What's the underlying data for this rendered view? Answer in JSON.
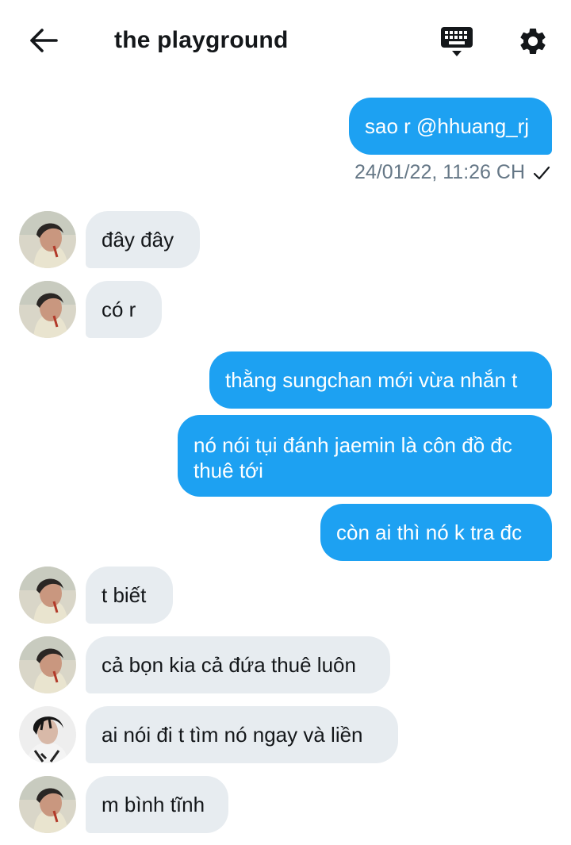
{
  "header": {
    "title": "the playground",
    "back_icon": "arrow-left-icon",
    "keyboard_icon": "keyboard-icon",
    "settings_icon": "gear-icon"
  },
  "colors": {
    "outgoing_bubble": "#1da1f2",
    "incoming_bubble": "#e7ecf0",
    "timestamp": "#657786"
  },
  "messages": [
    {
      "direction": "out",
      "text": "sao r @hhuang_rj"
    },
    {
      "direction": "status",
      "text": "24/01/22, 11:26 CH",
      "icon": "checkmark-icon"
    },
    {
      "direction": "in",
      "sender": "avatar-a",
      "text": "đây đây"
    },
    {
      "direction": "in",
      "sender": "avatar-a",
      "text": "có r"
    },
    {
      "direction": "out",
      "text": "thằng sungchan mới vừa nhắn t"
    },
    {
      "direction": "out",
      "text": "nó nói tụi đánh jaemin là côn đồ đc thuê tới"
    },
    {
      "direction": "out",
      "text": "còn ai thì nó k tra đc"
    },
    {
      "direction": "in",
      "sender": "avatar-a",
      "text": "t biết"
    },
    {
      "direction": "in",
      "sender": "avatar-a",
      "text": "cả bọn kia cả đứa thuê luôn"
    },
    {
      "direction": "in",
      "sender": "avatar-b",
      "text": "ai nói đi t tìm nó ngay và liền"
    },
    {
      "direction": "in",
      "sender": "avatar-a",
      "text": "m bình tĩnh"
    }
  ]
}
